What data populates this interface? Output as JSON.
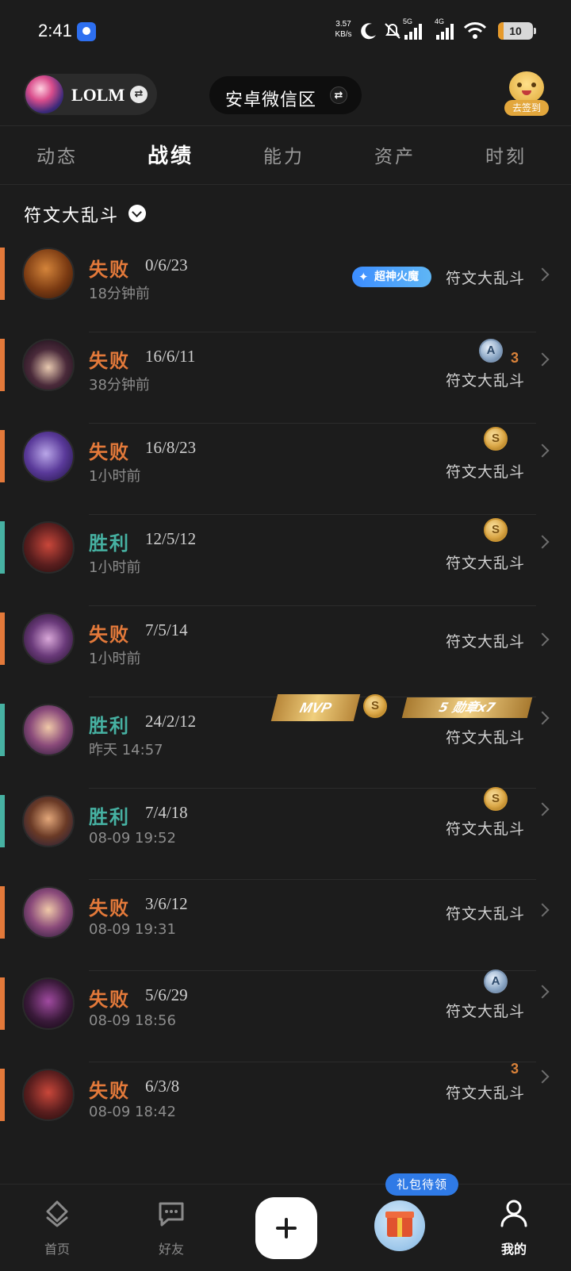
{
  "status_bar": {
    "time": "2:41",
    "net_speed_value": "3.57",
    "net_speed_unit": "KB/s",
    "network_5g": "5G",
    "network_4g": "4G",
    "battery": "10"
  },
  "header": {
    "game_label": "LOLM",
    "region_label": "安卓微信区",
    "checkin_label": "去签到"
  },
  "tabs": [
    "动态",
    "战绩",
    "能力",
    "资产",
    "时刻"
  ],
  "active_tab": "战绩",
  "filter": {
    "label": "符文大乱斗"
  },
  "matches": [
    {
      "result": "失败",
      "kda": "0/6/23",
      "time": "18分钟前",
      "mode": "符文大乱斗",
      "badge": "超神火魔"
    },
    {
      "result": "失败",
      "kda": "16/6/11",
      "time": "38分钟前",
      "mode": "符文大乱斗",
      "icons": [
        "A",
        "3"
      ]
    },
    {
      "result": "失败",
      "kda": "16/8/23",
      "time": "1小时前",
      "mode": "符文大乱斗",
      "icons": [
        "S"
      ]
    },
    {
      "result": "胜利",
      "kda": "12/5/12",
      "time": "1小时前",
      "mode": "符文大乱斗",
      "icons": [
        "S"
      ]
    },
    {
      "result": "失败",
      "kda": "7/5/14",
      "time": "1小时前",
      "mode": "符文大乱斗"
    },
    {
      "result": "胜利",
      "kda": "24/2/12",
      "time": "昨天 14:57",
      "mode": "符文大乱斗",
      "mvp": "MVP",
      "icons": [
        "S"
      ],
      "medal": "5 勋章x7"
    },
    {
      "result": "胜利",
      "kda": "7/4/18",
      "time": "08-09 19:52",
      "mode": "符文大乱斗",
      "icons": [
        "S"
      ]
    },
    {
      "result": "失败",
      "kda": "3/6/12",
      "time": "08-09 19:31",
      "mode": "符文大乱斗"
    },
    {
      "result": "失败",
      "kda": "5/6/29",
      "time": "08-09 18:56",
      "mode": "符文大乱斗",
      "icons": [
        "A"
      ]
    },
    {
      "result": "失败",
      "kda": "6/3/8",
      "time": "08-09 18:42",
      "mode": "符文大乱斗",
      "icons": [
        "3"
      ]
    }
  ],
  "bottom_nav": {
    "home": "首页",
    "friends": "好友",
    "gift_tag": "礼包待领",
    "me": "我的"
  },
  "colors": {
    "background": "#1c1c1c",
    "loss": "#e3793a",
    "win": "#46b1a2",
    "accent_blue": "#2f7ae6"
  }
}
